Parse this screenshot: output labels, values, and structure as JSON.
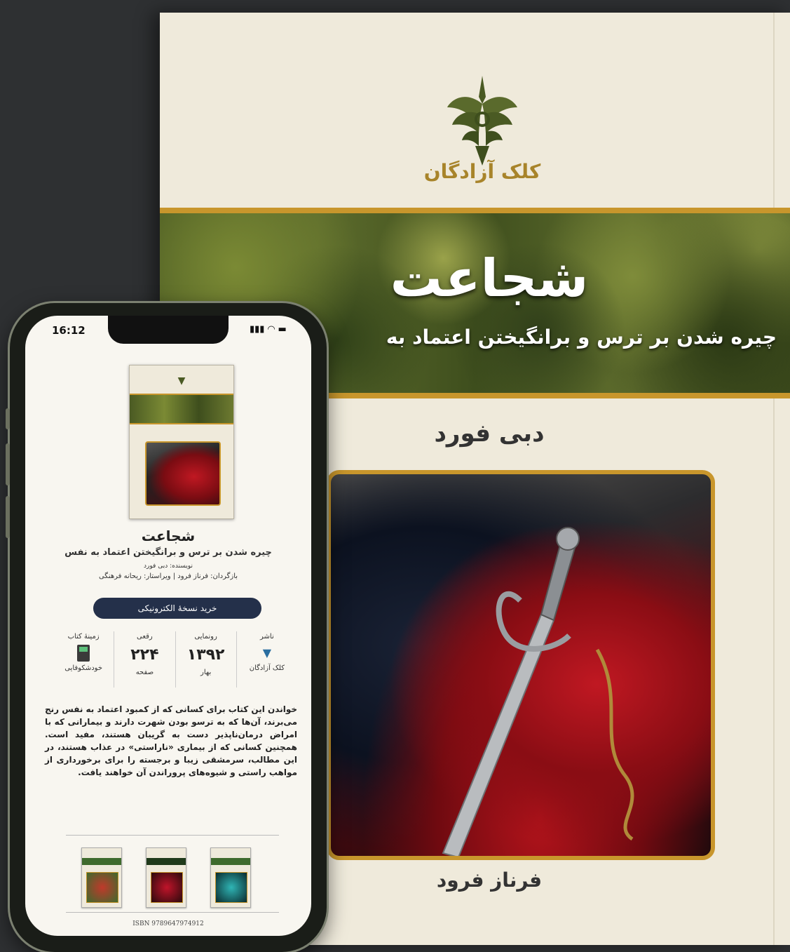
{
  "cover": {
    "publisher": "کلک آزادگان",
    "title": "شجاعت",
    "subtitle": "چیره شدن بر ترس و برانگیختن اعتماد به",
    "author": "دبی فورد",
    "translator": "فرناز فرود"
  },
  "phone": {
    "status": {
      "time": "16:12",
      "icons": "signal-wifi-battery"
    },
    "book": {
      "title": "شجاعت",
      "subtitle": "چیره شدن بر ترس و برانگیختن اعتماد به نفس",
      "author_line": "نویسنده: دبی فورد",
      "credits_line": "بازگردان: فرناز فرود | ویراستار: ریحانه فرهنگی"
    },
    "buy_label": "خرید نسخهٔ الکترونیکی",
    "info": [
      {
        "label": "ناشر",
        "value": "",
        "caption": "کلک آزادگان",
        "icon": "publisher-logo-icon"
      },
      {
        "label": "رونمایی",
        "value": "۱۳۹۲",
        "caption": "بهار"
      },
      {
        "label": "رقعی",
        "value": "۲۲۴",
        "caption": "صفحه"
      },
      {
        "label": "زمینهٔ کتاب",
        "value": "",
        "caption": "خودشکوفایی",
        "icon": "calculator-icon"
      }
    ],
    "description": "خواندن این کتاب برای کسانی که از کمبود اعتماد به نفس رنج می‌برند، آن‌ها که به ترسو بودن شهرت دارند و بیمارانی که با امراض درمان‌ناپذیر دست به گریبان هستند، مفید است. همچنین کسانی که از بیماری «ناراستی» در عذاب هستند، در این مطالب، سرمشقی زیبا و برجسته را برای برخورداری از مواهب راستی و شیوه‌های پروراندن آن خواهند یافت.",
    "isbn": "ISBN 9789647974912"
  },
  "colors": {
    "gold": "#c8962c",
    "navy": "#24304a",
    "cream": "#efeadb"
  }
}
